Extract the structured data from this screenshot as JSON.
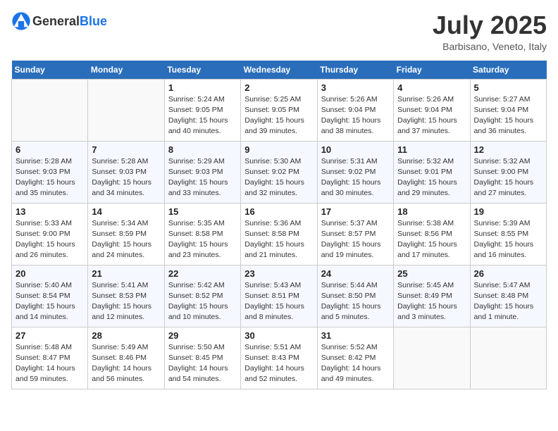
{
  "header": {
    "logo_general": "General",
    "logo_blue": "Blue",
    "month_year": "July 2025",
    "location": "Barbisano, Veneto, Italy"
  },
  "weekdays": [
    "Sunday",
    "Monday",
    "Tuesday",
    "Wednesday",
    "Thursday",
    "Friday",
    "Saturday"
  ],
  "weeks": [
    [
      {
        "day": "",
        "sunrise": "",
        "sunset": "",
        "daylight": ""
      },
      {
        "day": "",
        "sunrise": "",
        "sunset": "",
        "daylight": ""
      },
      {
        "day": "1",
        "sunrise": "Sunrise: 5:24 AM",
        "sunset": "Sunset: 9:05 PM",
        "daylight": "Daylight: 15 hours and 40 minutes."
      },
      {
        "day": "2",
        "sunrise": "Sunrise: 5:25 AM",
        "sunset": "Sunset: 9:05 PM",
        "daylight": "Daylight: 15 hours and 39 minutes."
      },
      {
        "day": "3",
        "sunrise": "Sunrise: 5:26 AM",
        "sunset": "Sunset: 9:04 PM",
        "daylight": "Daylight: 15 hours and 38 minutes."
      },
      {
        "day": "4",
        "sunrise": "Sunrise: 5:26 AM",
        "sunset": "Sunset: 9:04 PM",
        "daylight": "Daylight: 15 hours and 37 minutes."
      },
      {
        "day": "5",
        "sunrise": "Sunrise: 5:27 AM",
        "sunset": "Sunset: 9:04 PM",
        "daylight": "Daylight: 15 hours and 36 minutes."
      }
    ],
    [
      {
        "day": "6",
        "sunrise": "Sunrise: 5:28 AM",
        "sunset": "Sunset: 9:03 PM",
        "daylight": "Daylight: 15 hours and 35 minutes."
      },
      {
        "day": "7",
        "sunrise": "Sunrise: 5:28 AM",
        "sunset": "Sunset: 9:03 PM",
        "daylight": "Daylight: 15 hours and 34 minutes."
      },
      {
        "day": "8",
        "sunrise": "Sunrise: 5:29 AM",
        "sunset": "Sunset: 9:03 PM",
        "daylight": "Daylight: 15 hours and 33 minutes."
      },
      {
        "day": "9",
        "sunrise": "Sunrise: 5:30 AM",
        "sunset": "Sunset: 9:02 PM",
        "daylight": "Daylight: 15 hours and 32 minutes."
      },
      {
        "day": "10",
        "sunrise": "Sunrise: 5:31 AM",
        "sunset": "Sunset: 9:02 PM",
        "daylight": "Daylight: 15 hours and 30 minutes."
      },
      {
        "day": "11",
        "sunrise": "Sunrise: 5:32 AM",
        "sunset": "Sunset: 9:01 PM",
        "daylight": "Daylight: 15 hours and 29 minutes."
      },
      {
        "day": "12",
        "sunrise": "Sunrise: 5:32 AM",
        "sunset": "Sunset: 9:00 PM",
        "daylight": "Daylight: 15 hours and 27 minutes."
      }
    ],
    [
      {
        "day": "13",
        "sunrise": "Sunrise: 5:33 AM",
        "sunset": "Sunset: 9:00 PM",
        "daylight": "Daylight: 15 hours and 26 minutes."
      },
      {
        "day": "14",
        "sunrise": "Sunrise: 5:34 AM",
        "sunset": "Sunset: 8:59 PM",
        "daylight": "Daylight: 15 hours and 24 minutes."
      },
      {
        "day": "15",
        "sunrise": "Sunrise: 5:35 AM",
        "sunset": "Sunset: 8:58 PM",
        "daylight": "Daylight: 15 hours and 23 minutes."
      },
      {
        "day": "16",
        "sunrise": "Sunrise: 5:36 AM",
        "sunset": "Sunset: 8:58 PM",
        "daylight": "Daylight: 15 hours and 21 minutes."
      },
      {
        "day": "17",
        "sunrise": "Sunrise: 5:37 AM",
        "sunset": "Sunset: 8:57 PM",
        "daylight": "Daylight: 15 hours and 19 minutes."
      },
      {
        "day": "18",
        "sunrise": "Sunrise: 5:38 AM",
        "sunset": "Sunset: 8:56 PM",
        "daylight": "Daylight: 15 hours and 17 minutes."
      },
      {
        "day": "19",
        "sunrise": "Sunrise: 5:39 AM",
        "sunset": "Sunset: 8:55 PM",
        "daylight": "Daylight: 15 hours and 16 minutes."
      }
    ],
    [
      {
        "day": "20",
        "sunrise": "Sunrise: 5:40 AM",
        "sunset": "Sunset: 8:54 PM",
        "daylight": "Daylight: 15 hours and 14 minutes."
      },
      {
        "day": "21",
        "sunrise": "Sunrise: 5:41 AM",
        "sunset": "Sunset: 8:53 PM",
        "daylight": "Daylight: 15 hours and 12 minutes."
      },
      {
        "day": "22",
        "sunrise": "Sunrise: 5:42 AM",
        "sunset": "Sunset: 8:52 PM",
        "daylight": "Daylight: 15 hours and 10 minutes."
      },
      {
        "day": "23",
        "sunrise": "Sunrise: 5:43 AM",
        "sunset": "Sunset: 8:51 PM",
        "daylight": "Daylight: 15 hours and 8 minutes."
      },
      {
        "day": "24",
        "sunrise": "Sunrise: 5:44 AM",
        "sunset": "Sunset: 8:50 PM",
        "daylight": "Daylight: 15 hours and 5 minutes."
      },
      {
        "day": "25",
        "sunrise": "Sunrise: 5:45 AM",
        "sunset": "Sunset: 8:49 PM",
        "daylight": "Daylight: 15 hours and 3 minutes."
      },
      {
        "day": "26",
        "sunrise": "Sunrise: 5:47 AM",
        "sunset": "Sunset: 8:48 PM",
        "daylight": "Daylight: 15 hours and 1 minute."
      }
    ],
    [
      {
        "day": "27",
        "sunrise": "Sunrise: 5:48 AM",
        "sunset": "Sunset: 8:47 PM",
        "daylight": "Daylight: 14 hours and 59 minutes."
      },
      {
        "day": "28",
        "sunrise": "Sunrise: 5:49 AM",
        "sunset": "Sunset: 8:46 PM",
        "daylight": "Daylight: 14 hours and 56 minutes."
      },
      {
        "day": "29",
        "sunrise": "Sunrise: 5:50 AM",
        "sunset": "Sunset: 8:45 PM",
        "daylight": "Daylight: 14 hours and 54 minutes."
      },
      {
        "day": "30",
        "sunrise": "Sunrise: 5:51 AM",
        "sunset": "Sunset: 8:43 PM",
        "daylight": "Daylight: 14 hours and 52 minutes."
      },
      {
        "day": "31",
        "sunrise": "Sunrise: 5:52 AM",
        "sunset": "Sunset: 8:42 PM",
        "daylight": "Daylight: 14 hours and 49 minutes."
      },
      {
        "day": "",
        "sunrise": "",
        "sunset": "",
        "daylight": ""
      },
      {
        "day": "",
        "sunrise": "",
        "sunset": "",
        "daylight": ""
      }
    ]
  ]
}
